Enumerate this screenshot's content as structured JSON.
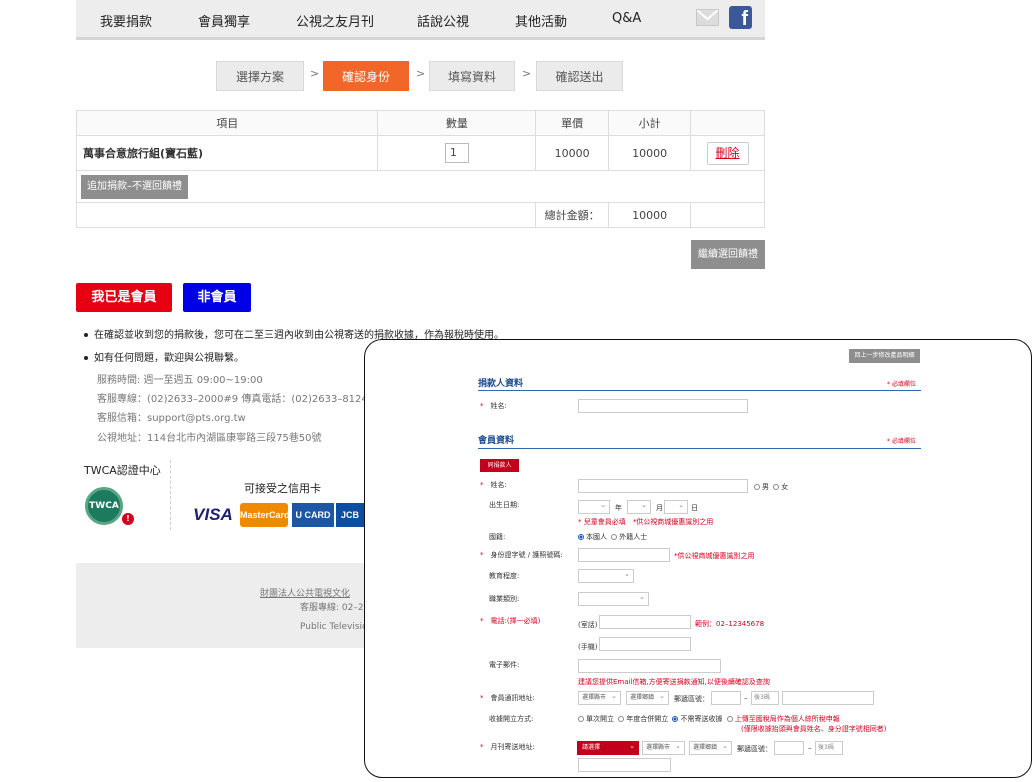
{
  "nav": {
    "items": [
      "我要捐款",
      "會員獨享",
      "公視之友月刊",
      "話說公視",
      "其他活動",
      "Q&A"
    ]
  },
  "steps": [
    "選擇方案",
    "確認身份",
    "填寫資料",
    "確認送出"
  ],
  "step_sep": ">",
  "cart": {
    "headers": [
      "項目",
      "數量",
      "單價",
      "小計"
    ],
    "item_name": "萬事合意旅行組(寶石藍)",
    "qty": "1",
    "price": "10000",
    "subtotal": "10000",
    "delete_label": "刪除",
    "add_label": "追加捐款–不選回饋禮",
    "total_label": "總計金額：",
    "total_value": "10000"
  },
  "continue_label": "繼續選回饋禮",
  "member_btn": "我已是會員",
  "nonmember_btn": "非會員",
  "notes": {
    "note1": "在確認並收到您的捐款後，您可在二至三週內收到由公視寄送的捐款收據，作為報稅時使用。",
    "note2": "如有任何問題，歡迎與公視聯繫。",
    "hours": "服務時間: 週一至週五 09:00~19:00",
    "hotline": "客服專線：(02)2633–2000#9 傳真電話：(02)2633–8124",
    "email": "客服信箱：support@pts.org.tw",
    "address": "公視地址：114台北市內湖區康寧路三段75巷50號"
  },
  "twca_label": "TWCA認證中心",
  "cards_label": "可接受之信用卡",
  "cards": [
    "VISA",
    "MasterCard",
    "U CARD",
    "JCB"
  ],
  "footer": {
    "line1": "財團法人公共電視文化",
    "line2": "客服專線: 02–2",
    "line3": "Public Televisio"
  },
  "overlay": {
    "back_btn": "回上一步修改產品明細",
    "donor_title": "捐款人資料",
    "required_note": "* 必填欄位",
    "donor_name": "姓名:",
    "member_title": "會員資料",
    "same_as_donor": "同捐款人",
    "name": "姓名:",
    "gender_m": "男",
    "gender_f": "女",
    "birth": "出生日期:",
    "year": "年",
    "month": "月",
    "day": "日",
    "birth_note": "* 兒童會員必填　*供公視商城優惠識別之用",
    "nationality": "國籍:",
    "nat_local": "本國人",
    "nat_foreign": "外籍人士",
    "id": "身份證字號 / 護照號碼:",
    "id_note": "*供公視商城優惠識別之用",
    "education": "教育程度:",
    "occupation": "職業類別:",
    "phone": "電話:(擇一必填)",
    "home": "(室話)",
    "phone_example": "範例：02–12345678",
    "mobile": "(手機)",
    "email": "電子郵件:",
    "email_note": "建議您提供Email信箱,方便寄送捐款通知,以便後續確認及查詢",
    "address": "會員通訊地址:",
    "city": "選擇縣市",
    "district": "選擇鄉鎮",
    "zip": "郵遞區號：",
    "zip3": "後3碼",
    "receipt": "收據開立方式:",
    "receipt_single": "單次開立",
    "receipt_year": "年度合併開立",
    "receipt_none": "不需寄送收據",
    "receipt_upload": "上傳至國稅局作為個人綜所稅申報",
    "receipt_upload_note": "(僅限收據抬頭與會員姓名、身分證字號相同者)",
    "magazine": "月刊寄送地址:",
    "please_select": "請選擇"
  }
}
